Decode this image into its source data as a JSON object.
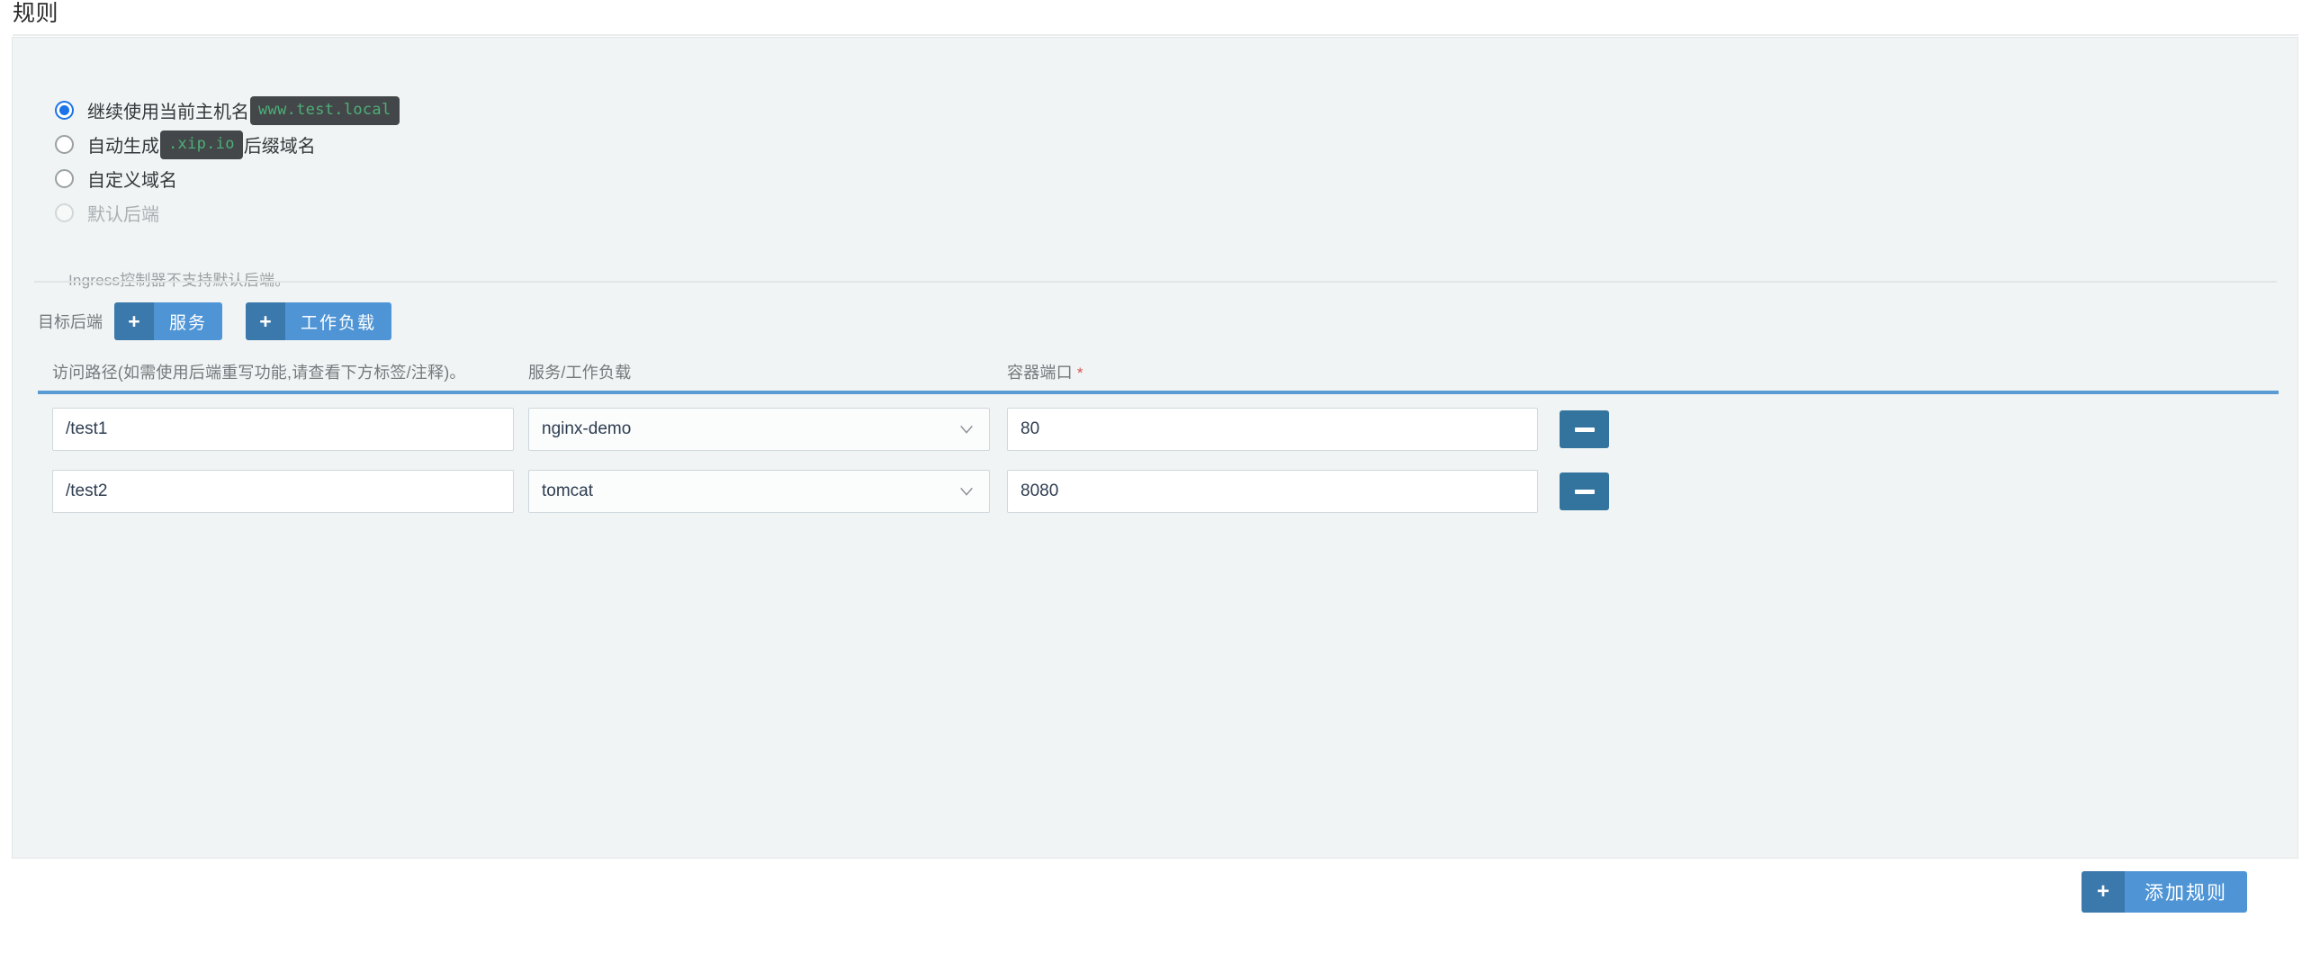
{
  "page": {
    "title": "规则"
  },
  "host_options": [
    {
      "label_before": "继续使用当前主机名",
      "code": "www.test.local",
      "label_after": "",
      "selected": true,
      "disabled": false
    },
    {
      "label_before": "自动生成",
      "code": ".xip.io",
      "label_after": "后缀域名",
      "selected": false,
      "disabled": false
    },
    {
      "label_before": "自定义域名",
      "code": "",
      "label_after": "",
      "selected": false,
      "disabled": false
    },
    {
      "label_before": "默认后端",
      "code": "",
      "label_after": "",
      "selected": false,
      "disabled": true
    }
  ],
  "helper_text": "Ingress控制器不支持默认后端。",
  "backend": {
    "label": "目标后端",
    "plus_glyph": "+",
    "buttons": [
      {
        "label": "服务"
      },
      {
        "label": "工作负载"
      }
    ]
  },
  "table": {
    "columns": [
      {
        "label": "访问路径(如需使用后端重写功能,请查看下方标签/注释)。",
        "required": false
      },
      {
        "label": "服务/工作负载",
        "required": false
      },
      {
        "label": "容器端口",
        "required": true,
        "required_mark": "*"
      }
    ],
    "rows": [
      {
        "path": "/test1",
        "path_placeholder": "",
        "service": "nginx-demo",
        "port": "80",
        "port_placeholder": ""
      },
      {
        "path": "/test2",
        "path_placeholder": "",
        "service": "tomcat",
        "port": "8080",
        "port_placeholder": ""
      }
    ]
  },
  "add_rule": {
    "plus_glyph": "+",
    "label": "添加规则"
  },
  "colors": {
    "accent_blue": "#4f95d6",
    "accent_blue_dark": "#3b78ab",
    "minus_blue": "#33749f",
    "radio_blue": "#1a73e8",
    "code_bg": "#444749",
    "code_fg": "#4caf78",
    "required_red": "#d9534f",
    "panel_bg": "#f1f4f4",
    "header_underline": "#5b9bd5"
  }
}
